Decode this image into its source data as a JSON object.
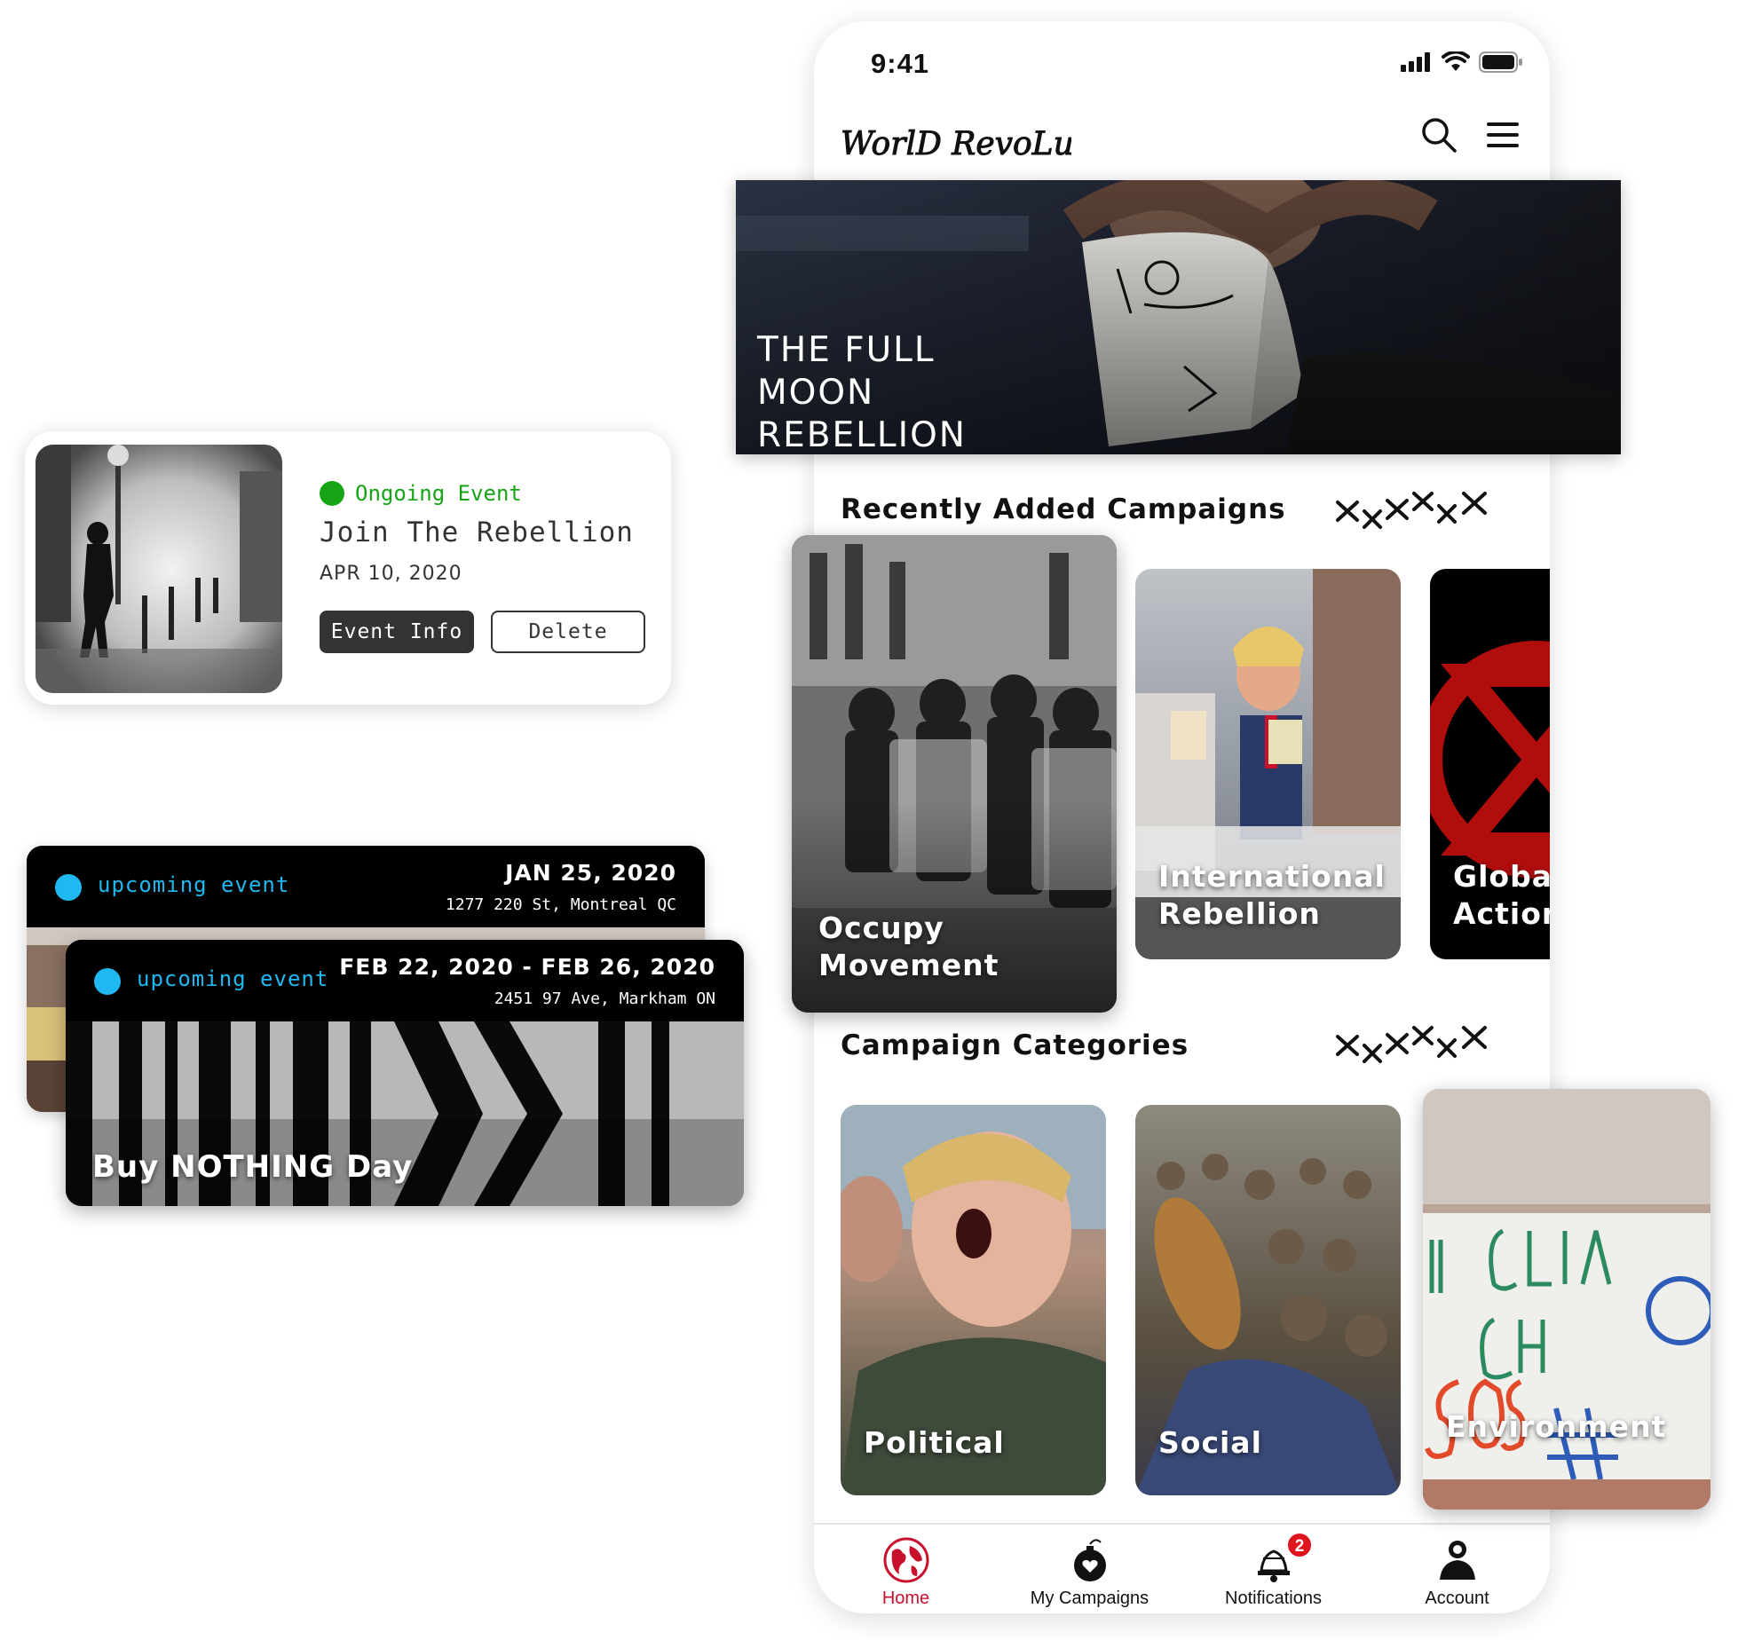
{
  "status_bar": {
    "time": "9:41"
  },
  "header": {
    "logo_text": "WorlD RevoLuTioN"
  },
  "hero": {
    "title_lines": [
      "THE FULL",
      "MOON",
      "REBELLION"
    ]
  },
  "sections": {
    "recent": {
      "title": "Recently Added Campaigns",
      "cards": [
        {
          "label_lines": [
            "Occupy",
            "Movement"
          ]
        },
        {
          "label_lines": [
            "International",
            "Rebellion"
          ]
        },
        {
          "label_lines": [
            "Global",
            "Action"
          ]
        }
      ]
    },
    "categories": {
      "title": "Campaign Categories",
      "cards": [
        {
          "label": "Political"
        },
        {
          "label": "Social"
        },
        {
          "label": "Environment"
        }
      ]
    }
  },
  "tabbar": {
    "items": [
      {
        "label": "Home",
        "active": true
      },
      {
        "label": "My Campaigns"
      },
      {
        "label": "Notifications",
        "badge": "2"
      },
      {
        "label": "Account"
      }
    ]
  },
  "ongoing_event": {
    "status": "Ongoing Event",
    "title": "Join The Rebellion",
    "date": "APR 10, 2020",
    "info_button": "Event Info",
    "delete_button": "Delete"
  },
  "upcoming_events": [
    {
      "status": "upcoming event",
      "date": "JAN 25, 2020",
      "address": "1277 220 St, Montreal QC"
    },
    {
      "status": "upcoming event",
      "date": "FEB 22, 2020 -  FEB 26, 2020",
      "address": "2451 97 Ave, Markham ON",
      "name": "Buy NOTHING Day"
    }
  ],
  "colors": {
    "accent_red": "#c8102e",
    "ongoing_green": "#16a316",
    "upcoming_blue": "#1fb8f0",
    "badge_red": "#e0141d"
  }
}
